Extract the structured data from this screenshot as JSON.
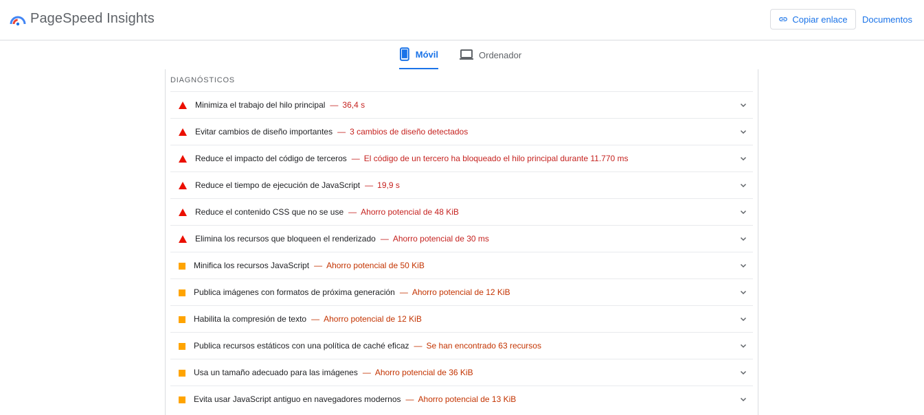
{
  "header": {
    "title": "PageSpeed Insights",
    "copy_label": "Copiar enlace",
    "docs_label": "Documentos"
  },
  "tabs": [
    {
      "label": "Móvil",
      "active": true,
      "icon": "smartphone-icon"
    },
    {
      "label": "Ordenador",
      "active": false,
      "icon": "laptop-icon"
    }
  ],
  "diagnostics": {
    "section_title": "DIAGNÓSTICOS",
    "items": [
      {
        "status": "fail",
        "title": "Minimiza el trabajo del hilo principal",
        "detail": "36,4 s"
      },
      {
        "status": "fail",
        "title": "Evitar cambios de diseño importantes",
        "detail": "3 cambios de diseño detectados"
      },
      {
        "status": "fail",
        "title": "Reduce el impacto del código de terceros",
        "detail": "El código de un tercero ha bloqueado el hilo principal durante 11.770 ms"
      },
      {
        "status": "fail",
        "title": "Reduce el tiempo de ejecución de JavaScript",
        "detail": "19,9 s"
      },
      {
        "status": "fail",
        "title": "Reduce el contenido CSS que no se use",
        "detail": "Ahorro potencial de 48 KiB"
      },
      {
        "status": "fail",
        "title": "Elimina los recursos que bloqueen el renderizado",
        "detail": "Ahorro potencial de 30 ms"
      },
      {
        "status": "average",
        "title": "Minifica los recursos JavaScript",
        "detail": "Ahorro potencial de 50 KiB"
      },
      {
        "status": "average",
        "title": "Publica imágenes con formatos de próxima generación",
        "detail": "Ahorro potencial de 12 KiB"
      },
      {
        "status": "average",
        "title": "Habilita la compresión de texto",
        "detail": "Ahorro potencial de 12 KiB"
      },
      {
        "status": "average",
        "title": "Publica recursos estáticos con una política de caché eficaz",
        "detail": "Se han encontrado 63 recursos"
      },
      {
        "status": "average",
        "title": "Usa un tamaño adecuado para las imágenes",
        "detail": "Ahorro potencial de 36 KiB"
      },
      {
        "status": "average",
        "title": "Evita usar JavaScript antiguo en navegadores modernos",
        "detail": "Ahorro potencial de 13 KiB"
      }
    ],
    "separator": "—"
  },
  "colors": {
    "accent": "#1a73e8",
    "fail": "#eb0f00",
    "average": "#ffa400",
    "fail_text": "#c5221f",
    "average_text": "#c33300"
  }
}
